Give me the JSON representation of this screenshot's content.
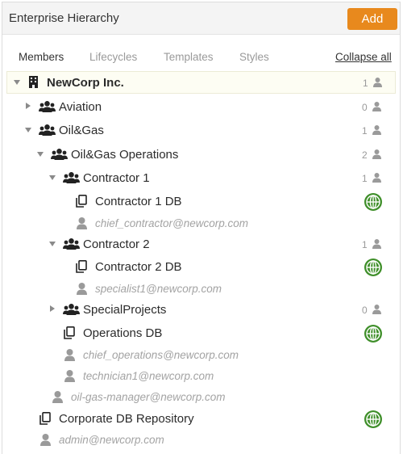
{
  "header": {
    "title": "Enterprise Hierarchy",
    "add_label": "Add"
  },
  "tabs": {
    "members": "Members",
    "lifecycles": "Lifecycles",
    "templates": "Templates",
    "styles": "Styles",
    "collapse_all": "Collapse all"
  },
  "tree": {
    "newcorp": {
      "label": "NewCorp Inc.",
      "count": "1"
    },
    "aviation": {
      "label": "Aviation",
      "count": "0"
    },
    "oilgas": {
      "label": "Oil&Gas",
      "count": "1"
    },
    "oilgas_ops": {
      "label": "Oil&Gas Operations",
      "count": "2"
    },
    "contractor1": {
      "label": "Contractor 1",
      "count": "1"
    },
    "contractor1_db": {
      "label": "Contractor 1 DB"
    },
    "chief_contractor": {
      "label": "chief_contractor@newcorp.com"
    },
    "contractor2": {
      "label": "Contractor 2",
      "count": "1"
    },
    "contractor2_db": {
      "label": "Contractor 2 DB"
    },
    "specialist1": {
      "label": "specialist1@newcorp.com"
    },
    "specialprojects": {
      "label": "SpecialProjects",
      "count": "0"
    },
    "operations_db": {
      "label": "Operations DB"
    },
    "chief_operations": {
      "label": "chief_operations@newcorp.com"
    },
    "technician1": {
      "label": "technician1@newcorp.com"
    },
    "oil_gas_manager": {
      "label": "oil-gas-manager@newcorp.com"
    },
    "corporate_db": {
      "label": "Corporate DB Repository"
    },
    "admin": {
      "label": "admin@newcorp.com"
    }
  },
  "colors": {
    "accent": "#e8891d",
    "globe": "#3f8f2a",
    "muted": "#9a9a9a"
  },
  "icons": {
    "building": "building-icon",
    "group": "group-icon",
    "database": "database-copy-icon",
    "user": "user-icon",
    "globe": "globe-icon"
  }
}
